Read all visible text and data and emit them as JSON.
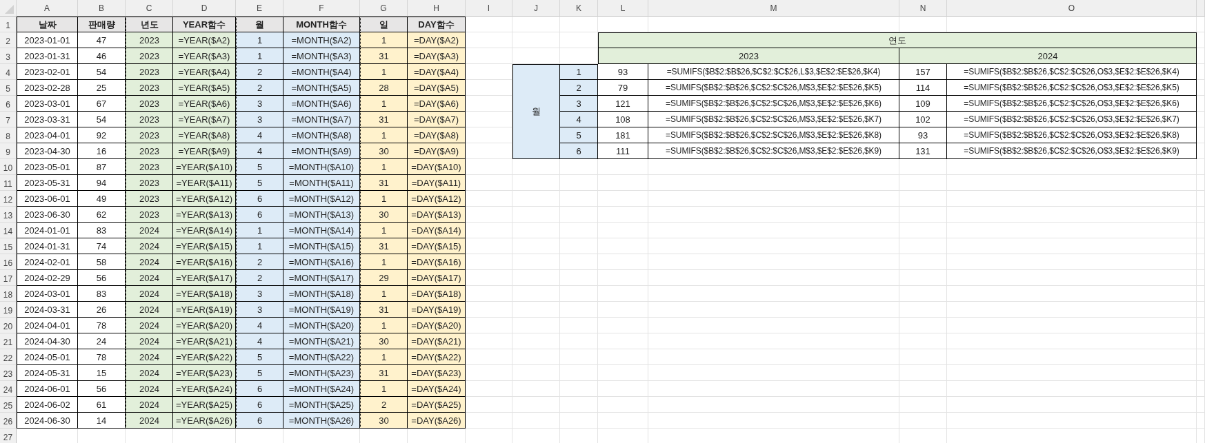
{
  "column_headers": [
    "A",
    "B",
    "C",
    "D",
    "E",
    "F",
    "G",
    "H",
    "I",
    "J",
    "K",
    "L",
    "M",
    "N",
    "O"
  ],
  "row_numbers": [
    "1",
    "2",
    "3",
    "4",
    "5",
    "6",
    "7",
    "8",
    "9",
    "10",
    "11",
    "12",
    "13",
    "14",
    "15",
    "16",
    "17",
    "18",
    "19",
    "20",
    "21",
    "22",
    "23",
    "24",
    "25",
    "26",
    "27"
  ],
  "sales_table": {
    "headers": [
      "날짜",
      "판매량",
      "년도",
      "YEAR함수",
      "월",
      "MONTH함수",
      "일",
      "DAY함수"
    ],
    "rows": [
      [
        "2023-01-01",
        "47",
        "2023",
        "=YEAR($A2)",
        "1",
        "=MONTH($A2)",
        "1",
        "=DAY($A2)"
      ],
      [
        "2023-01-31",
        "46",
        "2023",
        "=YEAR($A3)",
        "1",
        "=MONTH($A3)",
        "31",
        "=DAY($A3)"
      ],
      [
        "2023-02-01",
        "54",
        "2023",
        "=YEAR($A4)",
        "2",
        "=MONTH($A4)",
        "1",
        "=DAY($A4)"
      ],
      [
        "2023-02-28",
        "25",
        "2023",
        "=YEAR($A5)",
        "2",
        "=MONTH($A5)",
        "28",
        "=DAY($A5)"
      ],
      [
        "2023-03-01",
        "67",
        "2023",
        "=YEAR($A6)",
        "3",
        "=MONTH($A6)",
        "1",
        "=DAY($A6)"
      ],
      [
        "2023-03-31",
        "54",
        "2023",
        "=YEAR($A7)",
        "3",
        "=MONTH($A7)",
        "31",
        "=DAY($A7)"
      ],
      [
        "2023-04-01",
        "92",
        "2023",
        "=YEAR($A8)",
        "4",
        "=MONTH($A8)",
        "1",
        "=DAY($A8)"
      ],
      [
        "2023-04-30",
        "16",
        "2023",
        "=YEAR($A9)",
        "4",
        "=MONTH($A9)",
        "30",
        "=DAY($A9)"
      ],
      [
        "2023-05-01",
        "87",
        "2023",
        "=YEAR($A10)",
        "5",
        "=MONTH($A10)",
        "1",
        "=DAY($A10)"
      ],
      [
        "2023-05-31",
        "94",
        "2023",
        "=YEAR($A11)",
        "5",
        "=MONTH($A11)",
        "31",
        "=DAY($A11)"
      ],
      [
        "2023-06-01",
        "49",
        "2023",
        "=YEAR($A12)",
        "6",
        "=MONTH($A12)",
        "1",
        "=DAY($A12)"
      ],
      [
        "2023-06-30",
        "62",
        "2023",
        "=YEAR($A13)",
        "6",
        "=MONTH($A13)",
        "30",
        "=DAY($A13)"
      ],
      [
        "2024-01-01",
        "83",
        "2024",
        "=YEAR($A14)",
        "1",
        "=MONTH($A14)",
        "1",
        "=DAY($A14)"
      ],
      [
        "2024-01-31",
        "74",
        "2024",
        "=YEAR($A15)",
        "1",
        "=MONTH($A15)",
        "31",
        "=DAY($A15)"
      ],
      [
        "2024-02-01",
        "58",
        "2024",
        "=YEAR($A16)",
        "2",
        "=MONTH($A16)",
        "1",
        "=DAY($A16)"
      ],
      [
        "2024-02-29",
        "56",
        "2024",
        "=YEAR($A17)",
        "2",
        "=MONTH($A17)",
        "29",
        "=DAY($A17)"
      ],
      [
        "2024-03-01",
        "83",
        "2024",
        "=YEAR($A18)",
        "3",
        "=MONTH($A18)",
        "1",
        "=DAY($A18)"
      ],
      [
        "2024-03-31",
        "26",
        "2024",
        "=YEAR($A19)",
        "3",
        "=MONTH($A19)",
        "31",
        "=DAY($A19)"
      ],
      [
        "2024-04-01",
        "78",
        "2024",
        "=YEAR($A20)",
        "4",
        "=MONTH($A20)",
        "1",
        "=DAY($A20)"
      ],
      [
        "2024-04-30",
        "24",
        "2024",
        "=YEAR($A21)",
        "4",
        "=MONTH($A21)",
        "30",
        "=DAY($A21)"
      ],
      [
        "2024-05-01",
        "78",
        "2024",
        "=YEAR($A22)",
        "5",
        "=MONTH($A22)",
        "1",
        "=DAY($A22)"
      ],
      [
        "2024-05-31",
        "15",
        "2024",
        "=YEAR($A23)",
        "5",
        "=MONTH($A23)",
        "31",
        "=DAY($A23)"
      ],
      [
        "2024-06-01",
        "56",
        "2024",
        "=YEAR($A24)",
        "6",
        "=MONTH($A24)",
        "1",
        "=DAY($A24)"
      ],
      [
        "2024-06-02",
        "61",
        "2024",
        "=YEAR($A25)",
        "6",
        "=MONTH($A25)",
        "2",
        "=DAY($A25)"
      ],
      [
        "2024-06-30",
        "14",
        "2024",
        "=YEAR($A26)",
        "6",
        "=MONTH($A26)",
        "30",
        "=DAY($A26)"
      ]
    ]
  },
  "summary_table": {
    "title": "연도",
    "row_label": "월",
    "years": [
      "2023",
      "2024"
    ],
    "rows": [
      {
        "month": "1",
        "values": [
          {
            "value": "93",
            "formula": "=SUMIFS($B$2:$B$26,$C$2:$C$26,L$3,$E$2:$E$26,$K4)"
          },
          {
            "value": "157",
            "formula": "=SUMIFS($B$2:$B$26,$C$2:$C$26,O$3,$E$2:$E$26,$K4)"
          }
        ]
      },
      {
        "month": "2",
        "values": [
          {
            "value": "79",
            "formula": "=SUMIFS($B$2:$B$26,$C$2:$C$26,M$3,$E$2:$E$26,$K5)"
          },
          {
            "value": "114",
            "formula": "=SUMIFS($B$2:$B$26,$C$2:$C$26,O$3,$E$2:$E$26,$K5)"
          }
        ]
      },
      {
        "month": "3",
        "values": [
          {
            "value": "121",
            "formula": "=SUMIFS($B$2:$B$26,$C$2:$C$26,M$3,$E$2:$E$26,$K6)"
          },
          {
            "value": "109",
            "formula": "=SUMIFS($B$2:$B$26,$C$2:$C$26,O$3,$E$2:$E$26,$K6)"
          }
        ]
      },
      {
        "month": "4",
        "values": [
          {
            "value": "108",
            "formula": "=SUMIFS($B$2:$B$26,$C$2:$C$26,M$3,$E$2:$E$26,$K7)"
          },
          {
            "value": "102",
            "formula": "=SUMIFS($B$2:$B$26,$C$2:$C$26,O$3,$E$2:$E$26,$K7)"
          }
        ]
      },
      {
        "month": "5",
        "values": [
          {
            "value": "181",
            "formula": "=SUMIFS($B$2:$B$26,$C$2:$C$26,M$3,$E$2:$E$26,$K8)"
          },
          {
            "value": "93",
            "formula": "=SUMIFS($B$2:$B$26,$C$2:$C$26,O$3,$E$2:$E$26,$K8)"
          }
        ]
      },
      {
        "month": "6",
        "values": [
          {
            "value": "111",
            "formula": "=SUMIFS($B$2:$B$26,$C$2:$C$26,M$3,$E$2:$E$26,$K9)"
          },
          {
            "value": "131",
            "formula": "=SUMIFS($B$2:$B$26,$C$2:$C$26,O$3,$E$2:$E$26,$K9)"
          }
        ]
      }
    ]
  }
}
